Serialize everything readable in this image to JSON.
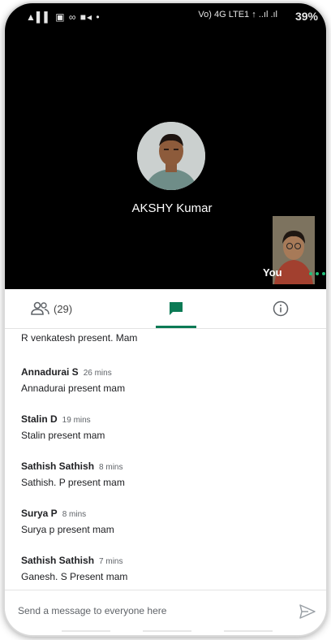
{
  "status_bar": {
    "left_text": "▲▌▌ ▣ ∞ ■◂ •",
    "network": "Vo) 4G LTE1 ↑ ..ıl .ıl",
    "battery": "39%"
  },
  "call": {
    "participant_name": "AKSHY Kumar",
    "self_label": "You"
  },
  "tabs": {
    "people_count": "(29)"
  },
  "messages": [
    {
      "sender": "",
      "time": "",
      "text": "R venkatesh  present. Mam"
    },
    {
      "sender": "Annadurai S",
      "time": "26 mins",
      "text": "Annadurai present mam"
    },
    {
      "sender": "Stalin D",
      "time": "19 mins",
      "text": "Stalin present mam"
    },
    {
      "sender": "Sathish Sathish",
      "time": "8 mins",
      "text": "Sathish. P present mam"
    },
    {
      "sender": "Surya P",
      "time": "8 mins",
      "text": "Surya p present mam"
    },
    {
      "sender": "Sathish Sathish",
      "time": "7 mins",
      "text": "Ganesh. S Present mam"
    }
  ],
  "composer": {
    "placeholder": "Send a message to everyone here",
    "value": ""
  },
  "colors": {
    "accent": "#0b7a55",
    "video_bg": "#000000"
  }
}
